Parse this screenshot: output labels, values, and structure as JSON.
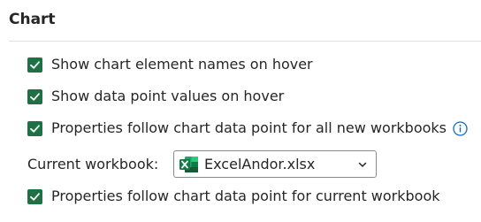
{
  "section": {
    "title": "Chart"
  },
  "options": [
    {
      "label": "Show chart element names on hover",
      "checked": true
    },
    {
      "label": "Show data point values on hover",
      "checked": true
    },
    {
      "label": "Properties follow chart data point for all new workbooks",
      "checked": true,
      "has_info": true
    }
  ],
  "workbook": {
    "label": "Current workbook:",
    "selected": "ExcelAndor.xlsx",
    "icon": "excel-file-icon"
  },
  "current_option": {
    "label": "Properties follow chart data point for current workbook",
    "checked": true
  },
  "colors": {
    "checkbox": "#1e7145",
    "info": "#0f6cbd",
    "excel_green": "#107c41"
  }
}
